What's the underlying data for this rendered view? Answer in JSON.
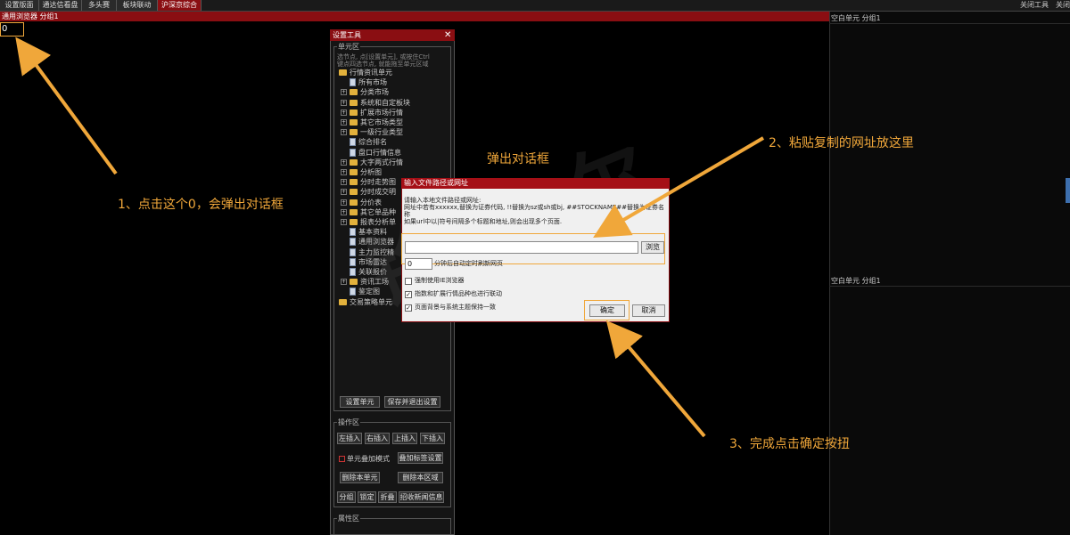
{
  "tabs": [
    "设置版面",
    "通达信看盘",
    "多头赛",
    "板块联动",
    "沪深京综合"
  ],
  "tab_right": {
    "tools": "关闭工具",
    "close": "关闭"
  },
  "topbar": {
    "label": "通用浏览器 分组1"
  },
  "cell_value": "0",
  "right_panels": {
    "top_label": "空白单元 分组1",
    "bottom_label": "空白单元 分组1"
  },
  "settings": {
    "title": "设置工具",
    "unit_section": "单元区",
    "hint1": "选节点, 点[设置单元], 或按住Ctrl",
    "hint2": "键点四选节点, 就能拖至单元区域",
    "tree": [
      {
        "label": "行情资讯单元",
        "kind": "folder",
        "expand": false
      },
      {
        "label": "所有市场",
        "kind": "doc",
        "expand": false
      },
      {
        "label": "分类市场",
        "kind": "folder",
        "expand": true
      },
      {
        "label": "系统和自定板块",
        "kind": "folder",
        "expand": true
      },
      {
        "label": "扩展市场行情",
        "kind": "folder",
        "expand": true
      },
      {
        "label": "其它市场类型",
        "kind": "folder",
        "expand": true
      },
      {
        "label": "一级行业类型",
        "kind": "folder",
        "expand": true
      },
      {
        "label": "综合排名",
        "kind": "doc",
        "expand": false
      },
      {
        "label": "盘口行情信息",
        "kind": "doc",
        "expand": false
      },
      {
        "label": "大字两式行情",
        "kind": "folder",
        "expand": true
      },
      {
        "label": "分析图",
        "kind": "folder",
        "expand": true
      },
      {
        "label": "分时走势图",
        "kind": "folder",
        "expand": true
      },
      {
        "label": "分时成交明",
        "kind": "folder",
        "expand": true
      },
      {
        "label": "分价表",
        "kind": "folder",
        "expand": true
      },
      {
        "label": "其它单品种",
        "kind": "folder",
        "expand": true
      },
      {
        "label": "报表分析单",
        "kind": "folder",
        "expand": true
      },
      {
        "label": "基本资料",
        "kind": "doc",
        "expand": false
      },
      {
        "label": "通用浏览器",
        "kind": "doc",
        "expand": false
      },
      {
        "label": "主力监控精",
        "kind": "doc",
        "expand": false
      },
      {
        "label": "市场雷达",
        "kind": "doc",
        "expand": false
      },
      {
        "label": "关联报价",
        "kind": "doc",
        "expand": false
      },
      {
        "label": "资讯工场",
        "kind": "folder",
        "expand": true
      },
      {
        "label": "鉴定图",
        "kind": "doc",
        "expand": false
      },
      {
        "label": "交易策略单元",
        "kind": "folder",
        "expand": false
      }
    ],
    "set_unit_btn": "设置单元",
    "save_exit_btn": "保存并退出设置",
    "ops_section": "操作区",
    "ops": {
      "left_insert": "左插入",
      "right_insert": "右插入",
      "up_insert": "上插入",
      "down_insert": "下插入",
      "overlay_mode": "单元叠加模式",
      "overlay_tag": "叠加标签设置",
      "delete_unit": "删除本单元",
      "delete_area": "删除本区域",
      "group": "分组",
      "lock": "锁定",
      "fold": "折叠",
      "news": "招收新闻信息"
    },
    "attr_section": "属性区"
  },
  "dialog": {
    "title": "输入文件路径或网址",
    "line1": "请输入本地文件路径或网址:",
    "line2": "网址中若有xxxxxx,替换为证券代码, !!替换为sz或sh或bj, ##STOCKNAME##替换为证券名称",
    "line3": "如果url中以|符号间隔多个标题和地址,则会出现多个页面.",
    "url_value": "",
    "browse_btn": "浏览",
    "minutes_value": "0",
    "minutes_label": "分钟后自动定时刷新网页",
    "opt_ie": "强制使用IE浏览器",
    "opt_link": "指数和扩展行情品种也进行联动",
    "opt_theme": "页面背景与系统主题保持一致",
    "opt_ie_checked": false,
    "opt_link_checked": true,
    "opt_theme_checked": true,
    "ok_btn": "确定",
    "cancel_btn": "取消"
  },
  "annotations": {
    "step1": "1、点击这个0，会弹出对话框",
    "popup": "弹出对话框",
    "step2": "2、粘贴复制的网址放这里",
    "step3": "3、完成点击确定按扭"
  },
  "colors": {
    "accent": "#f0a73a",
    "title_red": "#8a0e12"
  }
}
